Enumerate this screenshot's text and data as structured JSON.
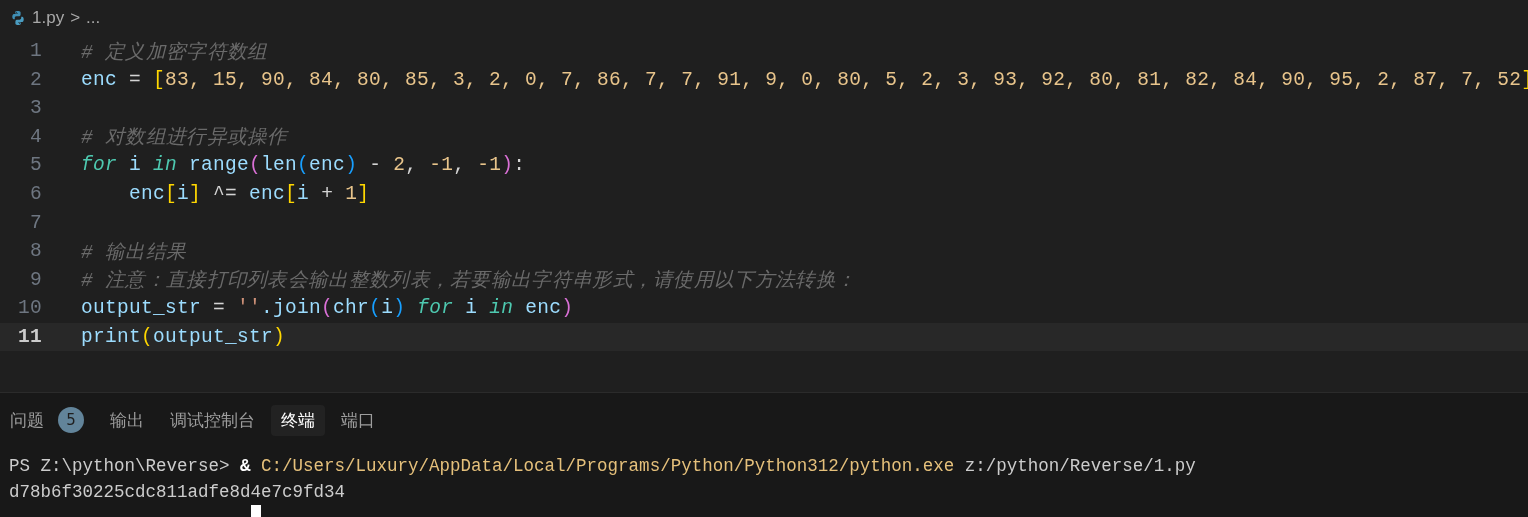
{
  "breadcrumb": {
    "file": "1.py",
    "separator": ">",
    "rest": "..."
  },
  "editor": {
    "lines": [
      {
        "number": "1",
        "active": false,
        "tokens": [
          {
            "text": "# 定义加密字符数组",
            "kind": "comment"
          }
        ]
      },
      {
        "number": "2",
        "active": false,
        "tokens": [
          {
            "text": "enc",
            "kind": "var"
          },
          {
            "text": " = ",
            "kind": "op"
          },
          {
            "text": "[",
            "kind": "bracket1"
          },
          {
            "text": "83, 15, 90, 84, 80, 85, 3, 2, 0, 7, 86, 7, 7, 91, 9, 0, 80, 5, 2, 3, 93, 92, 80, 81, 82, 84, 90, 95, 2, 87, 7, 52",
            "kind": "num"
          },
          {
            "text": "]",
            "kind": "bracket1"
          }
        ]
      },
      {
        "number": "3",
        "active": false
      },
      {
        "number": "4",
        "active": false,
        "tokens": [
          {
            "text": "# 对数组进行异或操作",
            "kind": "comment"
          }
        ]
      },
      {
        "number": "5",
        "active": false,
        "tokens": [
          {
            "text": "for",
            "kind": "keyword"
          },
          {
            "text": " i ",
            "kind": "var"
          },
          {
            "text": "in",
            "kind": "keyword"
          },
          {
            "text": " range",
            "kind": "func"
          },
          {
            "text": "(",
            "kind": "bracket2"
          },
          {
            "text": "len",
            "kind": "func"
          },
          {
            "text": "(",
            "kind": "bracket3"
          },
          {
            "text": "enc",
            "kind": "var"
          },
          {
            "text": ")",
            "kind": "bracket3"
          },
          {
            "text": " - ",
            "kind": "op"
          },
          {
            "text": "2",
            "kind": "num"
          },
          {
            "text": ", ",
            "kind": "op"
          },
          {
            "text": "-1",
            "kind": "num"
          },
          {
            "text": ", ",
            "kind": "op"
          },
          {
            "text": "-1",
            "kind": "num"
          },
          {
            "text": ")",
            "kind": "bracket2"
          },
          {
            "text": ":",
            "kind": "op"
          }
        ]
      },
      {
        "number": "6",
        "active": false,
        "tokens": [
          {
            "text": "    enc",
            "kind": "var"
          },
          {
            "text": "[",
            "kind": "bracket1"
          },
          {
            "text": "i",
            "kind": "var"
          },
          {
            "text": "]",
            "kind": "bracket1"
          },
          {
            "text": " ^= ",
            "kind": "op"
          },
          {
            "text": "enc",
            "kind": "var"
          },
          {
            "text": "[",
            "kind": "bracket1"
          },
          {
            "text": "i",
            "kind": "var"
          },
          {
            "text": " + ",
            "kind": "op"
          },
          {
            "text": "1",
            "kind": "num"
          },
          {
            "text": "]",
            "kind": "bracket1"
          }
        ]
      },
      {
        "number": "7",
        "active": false
      },
      {
        "number": "8",
        "active": false,
        "tokens": [
          {
            "text": "# 输出结果",
            "kind": "comment"
          }
        ]
      },
      {
        "number": "9",
        "active": false,
        "tokens": [
          {
            "text": "# 注意：直接打印列表会输出整数列表，若要输出字符串形式，请使用以下方法转换：",
            "kind": "comment"
          }
        ]
      },
      {
        "number": "10",
        "active": false,
        "tokens": [
          {
            "text": "output_str",
            "kind": "var"
          },
          {
            "text": " = ",
            "kind": "op"
          },
          {
            "text": "''",
            "kind": "string"
          },
          {
            "text": ".join",
            "kind": "func"
          },
          {
            "text": "(",
            "kind": "bracket2"
          },
          {
            "text": "chr",
            "kind": "func"
          },
          {
            "text": "(",
            "kind": "bracket3"
          },
          {
            "text": "i",
            "kind": "var"
          },
          {
            "text": ")",
            "kind": "bracket3"
          },
          {
            "text": " for",
            "kind": "keyword"
          },
          {
            "text": " i ",
            "kind": "var"
          },
          {
            "text": "in",
            "kind": "keyword"
          },
          {
            "text": " enc",
            "kind": "var"
          },
          {
            "text": ")",
            "kind": "bracket2"
          }
        ]
      },
      {
        "number": "11",
        "active": true,
        "tokens": [
          {
            "text": "print",
            "kind": "func"
          },
          {
            "text": "(",
            "kind": "bracket1"
          },
          {
            "text": "output_str",
            "kind": "var"
          },
          {
            "text": ")",
            "kind": "bracket1"
          }
        ]
      }
    ]
  },
  "panel": {
    "tabs": [
      {
        "label": "问题",
        "badge": "5",
        "selected": false
      },
      {
        "label": "输出",
        "selected": false
      },
      {
        "label": "调试控制台",
        "selected": false
      },
      {
        "label": "终端",
        "selected": true
      },
      {
        "label": "端口",
        "selected": false
      }
    ],
    "terminal": {
      "lines": [
        [
          {
            "text": "PS Z:\\python\\Reverse> ",
            "kind": "plain"
          },
          {
            "text": "& ",
            "kind": "bold"
          },
          {
            "text": "C:/Users/Luxury/AppData/Local/Programs/Python/Python312/python.exe",
            "kind": "path"
          },
          {
            "text": " z:/python/Reverse/1.py",
            "kind": "plain"
          }
        ],
        [
          {
            "text": "d78b6f30225cdc811adfe8d4e7c9fd34",
            "kind": "plain"
          }
        ]
      ]
    }
  }
}
